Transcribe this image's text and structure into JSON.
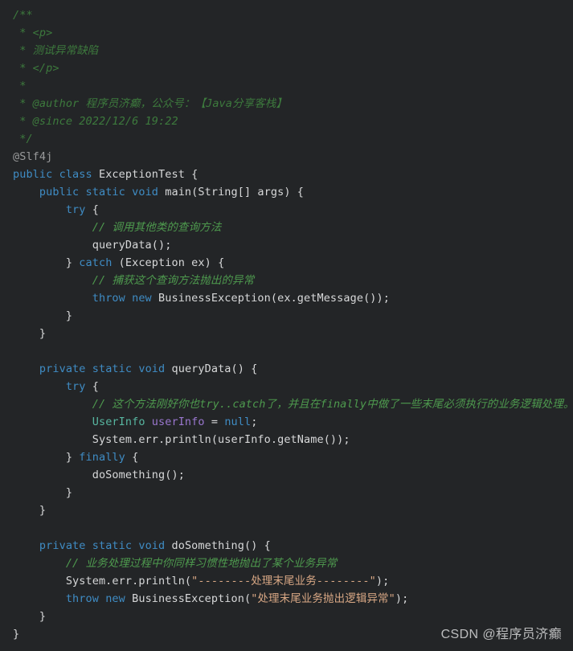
{
  "editor": {
    "background_color": "#232527",
    "default_text_color": "#d7d8d9",
    "language": "Java",
    "colors": {
      "doc_comment": "#3d7a3d",
      "line_comment": "#4e9a4e",
      "keyword": "#3f8cc4",
      "annotation": "#9a9b9c",
      "type": "#57b6a0",
      "field": "#9a77cf",
      "string": "#d9a885",
      "plain": "#d7d8d9"
    }
  },
  "lines": [
    {
      "n": 1,
      "segments": [
        {
          "t": "/**",
          "c": "doc"
        }
      ]
    },
    {
      "n": 2,
      "segments": [
        {
          "t": " * <p>",
          "c": "doc"
        }
      ]
    },
    {
      "n": 3,
      "segments": [
        {
          "t": " * 测试异常缺陷",
          "c": "doc"
        }
      ]
    },
    {
      "n": 4,
      "segments": [
        {
          "t": " * </p>",
          "c": "doc"
        }
      ]
    },
    {
      "n": 5,
      "segments": [
        {
          "t": " *",
          "c": "doc"
        }
      ]
    },
    {
      "n": 6,
      "segments": [
        {
          "t": " * @author 程序员济癫，公众号：【Java分享客栈】",
          "c": "doc"
        }
      ]
    },
    {
      "n": 7,
      "segments": [
        {
          "t": " * @since 2022/12/6 19:22",
          "c": "doc"
        }
      ]
    },
    {
      "n": 8,
      "segments": [
        {
          "t": " */",
          "c": "doc"
        }
      ]
    },
    {
      "n": 9,
      "segments": [
        {
          "t": "@Slf4j",
          "c": "annot"
        }
      ]
    },
    {
      "n": 10,
      "segments": [
        {
          "t": "public class ",
          "c": "keyword"
        },
        {
          "t": "ExceptionTest {",
          "c": "plain"
        }
      ]
    },
    {
      "n": 11,
      "segments": [
        {
          "t": "    ",
          "c": "plain"
        },
        {
          "t": "public static void ",
          "c": "keyword"
        },
        {
          "t": "main(String[] args) {",
          "c": "plain"
        }
      ]
    },
    {
      "n": 12,
      "segments": [
        {
          "t": "        ",
          "c": "plain"
        },
        {
          "t": "try",
          "c": "keyword"
        },
        {
          "t": " {",
          "c": "plain"
        }
      ]
    },
    {
      "n": 13,
      "segments": [
        {
          "t": "            ",
          "c": "plain"
        },
        {
          "t": "// 调用其他类的查询方法",
          "c": "linecmt"
        }
      ]
    },
    {
      "n": 14,
      "segments": [
        {
          "t": "            queryData();",
          "c": "plain"
        }
      ]
    },
    {
      "n": 15,
      "segments": [
        {
          "t": "        } ",
          "c": "plain"
        },
        {
          "t": "catch",
          "c": "keyword"
        },
        {
          "t": " (Exception ex) {",
          "c": "plain"
        }
      ]
    },
    {
      "n": 16,
      "segments": [
        {
          "t": "            ",
          "c": "plain"
        },
        {
          "t": "// 捕获这个查询方法抛出的异常",
          "c": "linecmt"
        }
      ]
    },
    {
      "n": 17,
      "segments": [
        {
          "t": "            ",
          "c": "plain"
        },
        {
          "t": "throw new ",
          "c": "keyword"
        },
        {
          "t": "BusinessException(ex.getMessage());",
          "c": "plain"
        }
      ]
    },
    {
      "n": 18,
      "segments": [
        {
          "t": "        }",
          "c": "plain"
        }
      ]
    },
    {
      "n": 19,
      "segments": [
        {
          "t": "    }",
          "c": "plain"
        }
      ]
    },
    {
      "n": 20,
      "segments": [
        {
          "t": "",
          "c": "plain"
        }
      ]
    },
    {
      "n": 21,
      "segments": [
        {
          "t": "    ",
          "c": "plain"
        },
        {
          "t": "private static void ",
          "c": "keyword"
        },
        {
          "t": "queryData() {",
          "c": "plain"
        }
      ]
    },
    {
      "n": 22,
      "segments": [
        {
          "t": "        ",
          "c": "plain"
        },
        {
          "t": "try",
          "c": "keyword"
        },
        {
          "t": " {",
          "c": "plain"
        }
      ]
    },
    {
      "n": 23,
      "segments": [
        {
          "t": "            ",
          "c": "plain"
        },
        {
          "t": "// 这个方法刚好你也try..catch了，并且在finally中做了一些末尾必须执行的业务逻辑处理。",
          "c": "linecmt"
        }
      ]
    },
    {
      "n": 24,
      "segments": [
        {
          "t": "            ",
          "c": "plain"
        },
        {
          "t": "UserInfo",
          "c": "type"
        },
        {
          "t": " ",
          "c": "plain"
        },
        {
          "t": "userInfo",
          "c": "field"
        },
        {
          "t": " = ",
          "c": "plain"
        },
        {
          "t": "null",
          "c": "keyword"
        },
        {
          "t": ";",
          "c": "plain"
        }
      ]
    },
    {
      "n": 25,
      "segments": [
        {
          "t": "            System.err.println(userInfo.getName());",
          "c": "plain"
        }
      ]
    },
    {
      "n": 26,
      "segments": [
        {
          "t": "        } ",
          "c": "plain"
        },
        {
          "t": "finally",
          "c": "keyword"
        },
        {
          "t": " {",
          "c": "plain"
        }
      ]
    },
    {
      "n": 27,
      "segments": [
        {
          "t": "            doSomething();",
          "c": "plain"
        }
      ]
    },
    {
      "n": 28,
      "segments": [
        {
          "t": "        }",
          "c": "plain"
        }
      ]
    },
    {
      "n": 29,
      "segments": [
        {
          "t": "    }",
          "c": "plain"
        }
      ]
    },
    {
      "n": 30,
      "segments": [
        {
          "t": "",
          "c": "plain"
        }
      ]
    },
    {
      "n": 31,
      "segments": [
        {
          "t": "    ",
          "c": "plain"
        },
        {
          "t": "private static void ",
          "c": "keyword"
        },
        {
          "t": "doSomething() {",
          "c": "plain"
        }
      ]
    },
    {
      "n": 32,
      "segments": [
        {
          "t": "        ",
          "c": "plain"
        },
        {
          "t": "// 业务处理过程中你同样习惯性地抛出了某个业务异常",
          "c": "linecmt"
        }
      ]
    },
    {
      "n": 33,
      "segments": [
        {
          "t": "        System.err.println(",
          "c": "plain"
        },
        {
          "t": "\"--------处理末尾业务--------\"",
          "c": "string"
        },
        {
          "t": ");",
          "c": "plain"
        }
      ]
    },
    {
      "n": 34,
      "segments": [
        {
          "t": "        ",
          "c": "plain"
        },
        {
          "t": "throw new ",
          "c": "keyword"
        },
        {
          "t": "BusinessException(",
          "c": "plain"
        },
        {
          "t": "\"处理末尾业务抛出逻辑异常\"",
          "c": "string"
        },
        {
          "t": ");",
          "c": "plain"
        }
      ]
    },
    {
      "n": 35,
      "segments": [
        {
          "t": "    }",
          "c": "plain"
        }
      ]
    },
    {
      "n": 36,
      "segments": [
        {
          "t": "}",
          "c": "plain"
        }
      ]
    }
  ],
  "watermark": {
    "text": "CSDN @程序员济癫"
  }
}
